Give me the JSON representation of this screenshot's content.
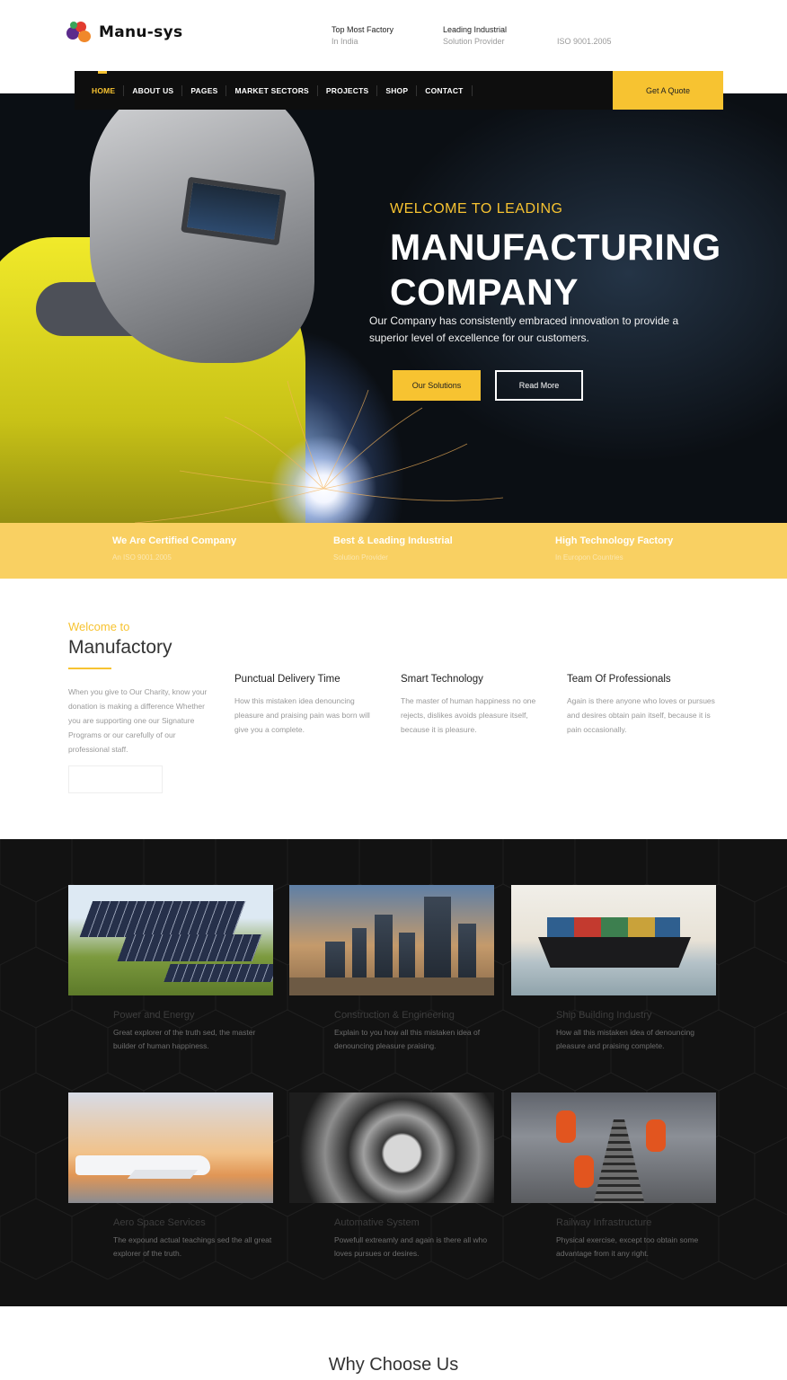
{
  "header": {
    "logo_text": "Manu-sys",
    "info": [
      {
        "line1": "Top Most Factory",
        "line2": "In India"
      },
      {
        "line1": "Leading Industrial",
        "line2": "Solution Provider"
      },
      {
        "line1": "",
        "line2": "ISO 9001.2005"
      }
    ]
  },
  "nav": {
    "items": [
      "HOME",
      "ABOUT US",
      "PAGES",
      "MARKET SECTORS",
      "PROJECTS",
      "SHOP",
      "CONTACT"
    ],
    "quote_label": "Get A Quote"
  },
  "hero": {
    "subtitle": "WELCOME TO LEADING",
    "title_line1": "MANUFACTURING",
    "title_line2": "COMPANY",
    "description": "Our Company has consistently embraced innovation to provide a superior level of excellence for our customers.",
    "btn_primary": "Our Solutions",
    "btn_secondary": "Read More"
  },
  "strip": [
    {
      "title": "We Are Certified Company",
      "sub": "An ISO 9001.2005"
    },
    {
      "title": "Best & Leading Industrial",
      "sub": "Solution Provider"
    },
    {
      "title": "High Technology Factory",
      "sub": "In Europon Countries"
    }
  ],
  "welcome": {
    "small": "Welcome to",
    "big": "Manufactory",
    "paragraph": "When you give to Our Charity, know your donation is making a difference Whether you are supporting one our Signature Programs or our carefully of our professional staff.",
    "features": [
      {
        "title": "Punctual Delivery Time",
        "text": "How this mistaken idea denouncing pleasure and praising pain was born will give you a complete."
      },
      {
        "title": "Smart Technology",
        "text": "The master of human happiness no one rejects, dislikes avoids pleasure itself, because it is pleasure."
      },
      {
        "title": "Team Of Professionals",
        "text": "Again is there anyone who loves or pursues and desires obtain pain itself, because it is pain occasionally."
      }
    ]
  },
  "services": [
    {
      "title": "Power and Energy",
      "text": "Great explorer of the truth sed, the master builder of human happiness.",
      "icon": "solar-panels-image"
    },
    {
      "title": "Construction & Engineering",
      "text": "Explain to you how all this mistaken idea of denouncing pleasure praising.",
      "icon": "city-construction-image"
    },
    {
      "title": "Ship Building Industry",
      "text": "How all this mistaken idea of denouncing pleasure and praising complete.",
      "icon": "cargo-ship-image"
    },
    {
      "title": "Aero Space Services",
      "text": "The expound actual teachings sed the all great explorer of the truth.",
      "icon": "airplane-image"
    },
    {
      "title": "Automative System",
      "text": "Powefull extreamly and again is there all who loves pursues or desires.",
      "icon": "engine-image"
    },
    {
      "title": "Railway Infrastructure",
      "text": "Physical exercise, except too obtain some advantage from it any right.",
      "icon": "railway-workers-image"
    }
  ],
  "why": {
    "title": "Why Choose Us"
  },
  "colors": {
    "accent": "#f7c331",
    "dark": "#121212",
    "strip": "#f9d062"
  }
}
